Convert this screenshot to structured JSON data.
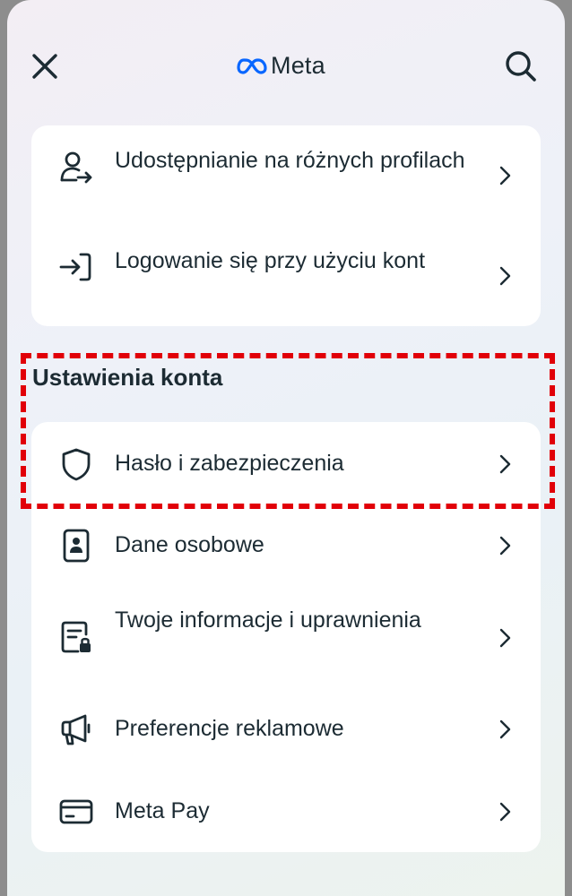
{
  "header": {
    "brand": "Meta",
    "close_icon": "close-icon",
    "search_icon": "search-icon"
  },
  "top_card": {
    "items": [
      {
        "label": "Udostępnianie na różnych profilach",
        "icon": "person-share-icon"
      },
      {
        "label": "Logowanie się przy użyciu kont",
        "icon": "login-arrow-icon"
      }
    ]
  },
  "account_section": {
    "title": "Ustawienia konta",
    "items": [
      {
        "label": "Hasło i zabezpieczenia",
        "icon": "shield-icon"
      },
      {
        "label": "Dane osobowe",
        "icon": "id-badge-icon"
      },
      {
        "label": "Twoje informacje i uprawnienia",
        "icon": "document-lock-icon"
      },
      {
        "label": "Preferencje reklamowe",
        "icon": "megaphone-icon"
      },
      {
        "label": "Meta Pay",
        "icon": "credit-card-icon"
      }
    ]
  },
  "colors": {
    "highlight": "#e10008",
    "meta_blue": "#0866ff",
    "text": "#1c2b33"
  }
}
